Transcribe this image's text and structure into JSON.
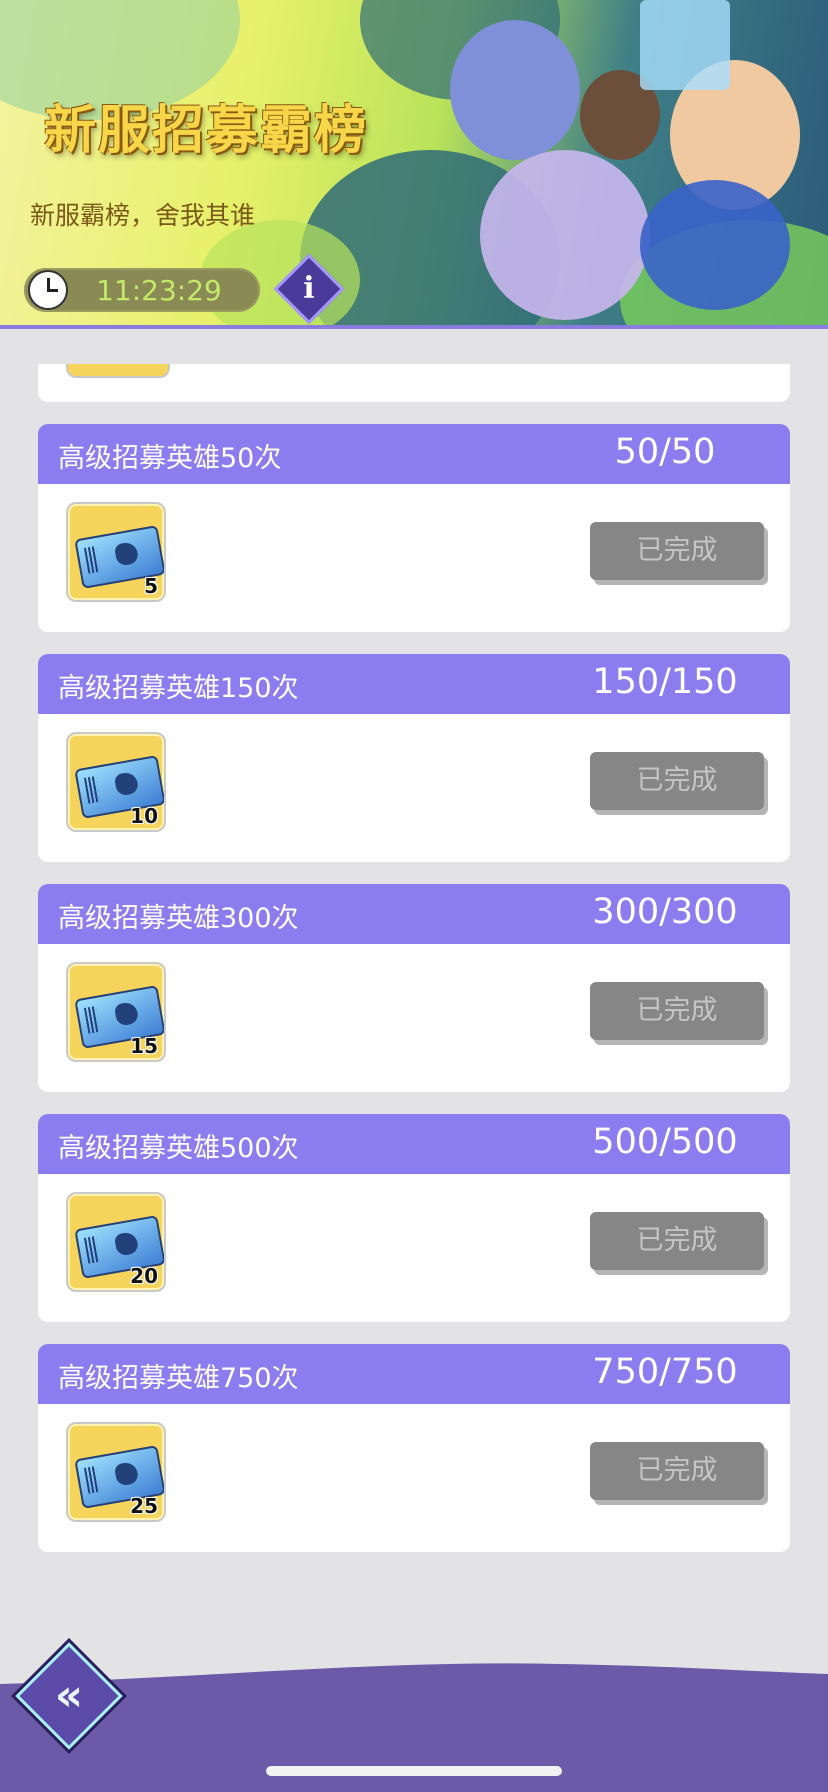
{
  "banner": {
    "title": "新服招募霸榜",
    "subtitle": "新服霸榜，舍我其谁",
    "timer": "11:23:29",
    "info_label": "i"
  },
  "list": {
    "items": [
      {
        "title": "高级招募英雄50次",
        "progress": "50/50",
        "reward_count": "5",
        "status": "已完成"
      },
      {
        "title": "高级招募英雄150次",
        "progress": "150/150",
        "reward_count": "10",
        "status": "已完成"
      },
      {
        "title": "高级招募英雄300次",
        "progress": "300/300",
        "reward_count": "15",
        "status": "已完成"
      },
      {
        "title": "高级招募英雄500次",
        "progress": "500/500",
        "reward_count": "20",
        "status": "已完成"
      },
      {
        "title": "高级招募英雄750次",
        "progress": "750/750",
        "reward_count": "25",
        "status": "已完成"
      }
    ]
  },
  "bottom": {
    "back_label": "«"
  },
  "colors": {
    "header_purple": "#8b7cf0",
    "done_button": "#868686",
    "footer_purple": "#6a5aa8",
    "title_gold": "#f7d64a"
  }
}
